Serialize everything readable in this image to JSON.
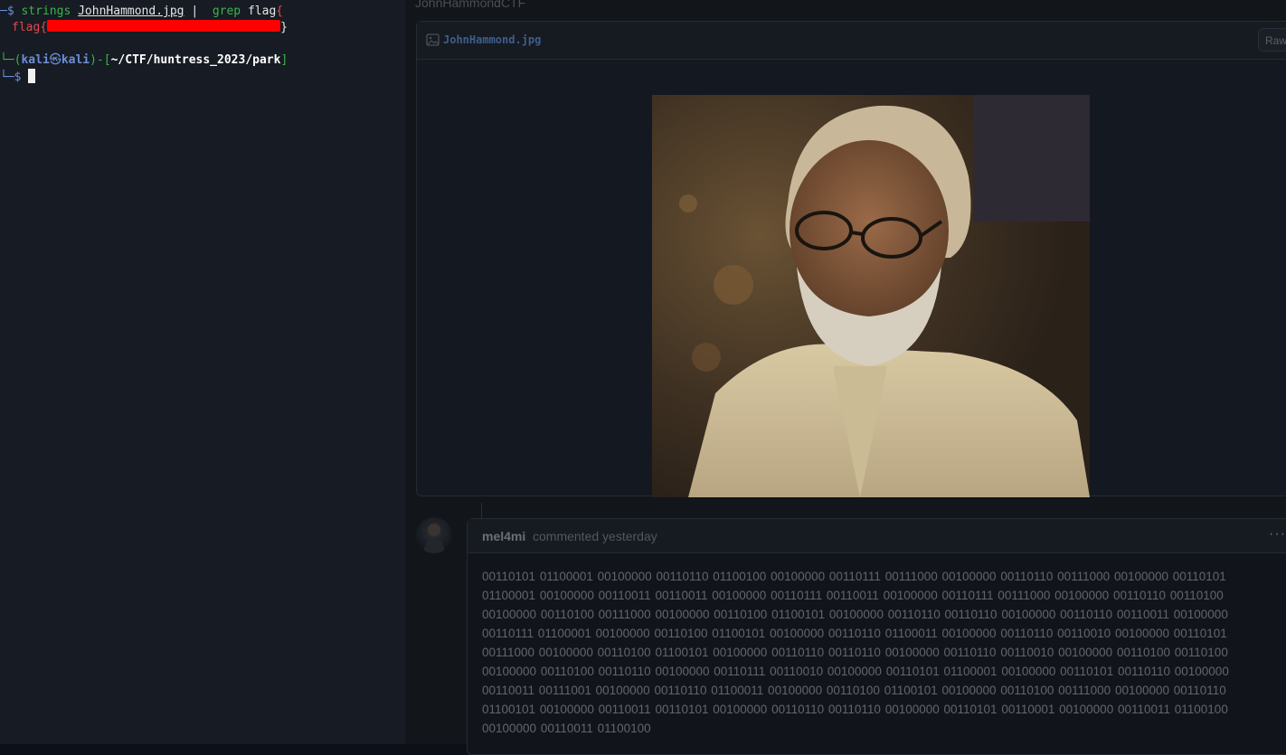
{
  "terminal": {
    "line1": {
      "prompt_arrow": "─$ ",
      "cmd": "strings",
      "file": "JohnHammond.jpg",
      "pipe": " |  ",
      "grep": "grep",
      "arg_a": " flag",
      "arg_b": "{"
    },
    "line2": {
      "flag_prefix": "flag{",
      "flag_suffix": "}"
    },
    "line3": {
      "corner": "└─",
      "open": "(",
      "user": "kali",
      "at": "㉿",
      "host": "kali",
      "close": ")-[",
      "path": "~/CTF/huntress_2023/park",
      "end": "]"
    },
    "line4": {
      "prompt": "└─$ "
    }
  },
  "browser": {
    "repo_owner": "JohnHammondCTF",
    "file": {
      "name": "JohnHammond.jpg",
      "raw_label": "Raw"
    },
    "comment": {
      "author": "mel4mi",
      "meta": "commented yesterday",
      "menu": "···",
      "body": "00110101 01100001 00100000 00110110 01100100 00100000 00110111 00111000 00100000 00110110 00111000 00100000 00110101 01100001 00100000 00110011 00110011 00100000 00110111 00110011 00100000 00110111 00111000 00100000 00110110 00110100 00100000 00110100 00111000 00100000 00110100 01100101 00100000 00110110 00110110 00100000 00110110 00110011 00100000 00110111 01100001 00100000 00110100 01100101 00100000 00110110 01100011 00100000 00110110 00110010 00100000 00110101 00111000 00100000 00110100 01100101 00100000 00110110 00110110 00100000 00110110 00110010 00100000 00110100 00110100 00100000 00110100 00110110 00100000 00110111 00110010 00100000 00110101 01100001 00100000 00110101 00110110 00100000 00110011 00111001 00100000 00110110 01100011 00100000 00110100 01100101 00100000 00110100 00111000 00100000 00110110 01100101 00100000 00110011 00110101 00100000 00110110 00110110 00100000 00110101 00110001 00100000 00110011 01100100 00100000 00110011 01100100"
    }
  }
}
